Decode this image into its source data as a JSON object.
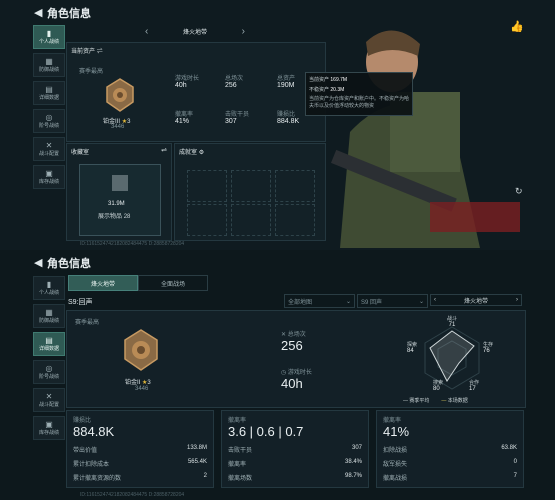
{
  "top": {
    "title": "角色信息",
    "sidebar": [
      "个人战绩",
      "防御战绩",
      "详细数据",
      "阶号战绩",
      "战斗配置",
      "库存战绩"
    ],
    "season_label": "烽火地带",
    "asset_section": "当前资产",
    "rank_caption": "赛季最高",
    "rank_text": "铂金III",
    "rank_stars": "3",
    "rank_points": "3446",
    "stats": [
      {
        "label": "游戏时长",
        "value": "40h"
      },
      {
        "label": "总场次",
        "value": "256"
      },
      {
        "label": "总资产",
        "value": "190M"
      },
      {
        "label": "撤离率",
        "value": "41%"
      },
      {
        "label": "击败干员",
        "value": "307"
      },
      {
        "label": "赚损比",
        "value": "884.8K"
      }
    ],
    "tooltip": {
      "line1_label": "当前资产",
      "line1_value": "169.7M",
      "line2_label": "不稳资产",
      "line2_value": "20.3M",
      "desc": "当前资产为仓库资产和账户中。不稳资产为哈夫币以及价值浮动较大的物资"
    },
    "collection_title": "收藏室",
    "collection_value": "31.9M",
    "collection_count_label": "展示物品",
    "collection_count": "28",
    "achievement_title": "成就室",
    "uid": "ID:1161524742182082484475 D:28858728204"
  },
  "bottom": {
    "title": "角色信息",
    "sidebar": [
      "个人战绩",
      "防御战绩",
      "详细数据",
      "阶号战绩",
      "战斗配置",
      "库存战绩"
    ],
    "tabs": [
      "烽火地带",
      "全面战场"
    ],
    "season": "S9:回声",
    "filter1": "全部地图",
    "filter2": "S9 回声",
    "mode": "烽火地带",
    "rank_caption": "赛季最高",
    "rank_text": "铂金II",
    "rank_stars": "3",
    "rank_points": "3446",
    "total_matches_label": "总场次",
    "total_matches": "256",
    "playtime_label": "游戏时长",
    "playtime": "40h",
    "radar": {
      "labels": [
        "战斗",
        "生存",
        "合作",
        "搜索",
        "探索",
        "收集"
      ],
      "values": [
        "71",
        "76",
        "17",
        "80",
        "84",
        ""
      ]
    },
    "legend": [
      "赛季平均",
      "本场数据"
    ],
    "cards": [
      {
        "title": "赚损比",
        "big": "884.8K",
        "rows": [
          [
            "带出价值",
            "133.8M"
          ],
          [
            "累计扣除成本",
            "565.4K"
          ],
          [
            "累计撤离资源的数",
            "2"
          ]
        ]
      },
      {
        "title": "撤离率",
        "big": "3.6 | 0.6 | 0.7",
        "rows": [
          [
            "击败干员",
            "307"
          ],
          [
            "撤离率",
            "38.4%"
          ],
          [
            "撤离场数",
            "98.7%"
          ]
        ]
      },
      {
        "title": "撤离率",
        "big": "41%",
        "rows": [
          [
            "扣除战损",
            "63.8K"
          ],
          [
            "敌军损失",
            "0"
          ],
          [
            "撤离战损",
            "7"
          ]
        ]
      }
    ],
    "uid": "ID:1161524742182082484475 D:28858728204"
  }
}
